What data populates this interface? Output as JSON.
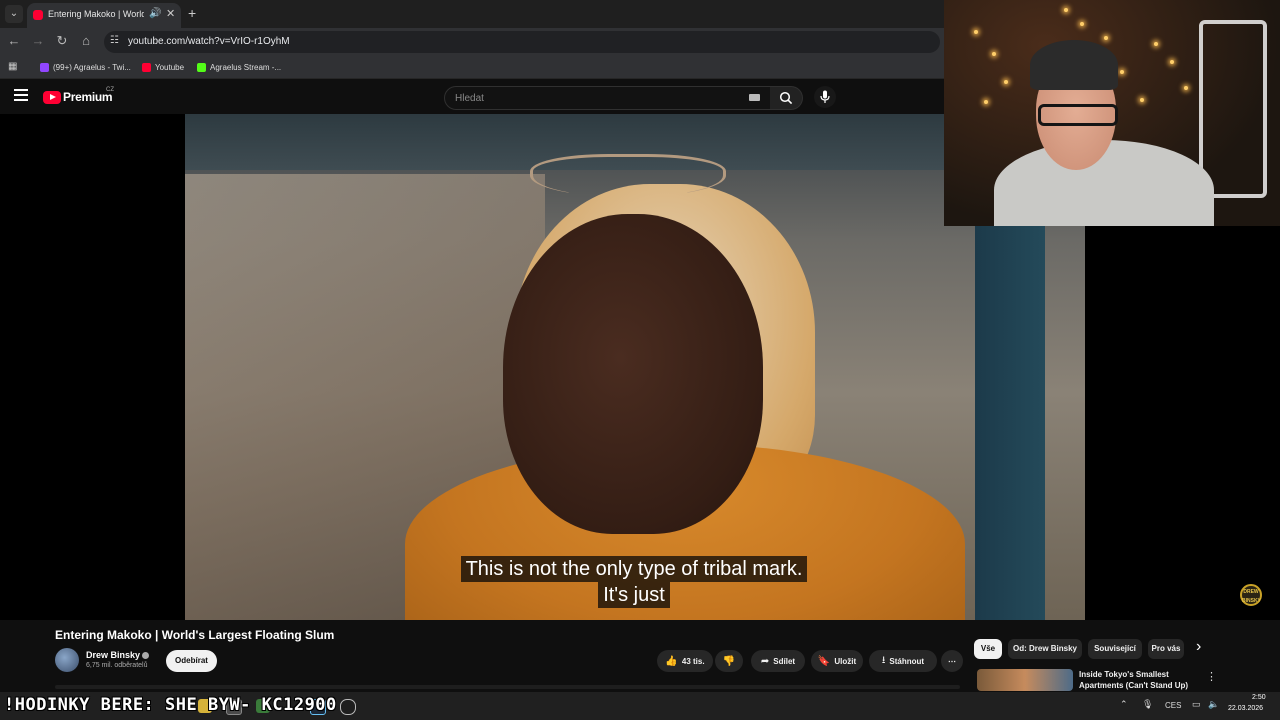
{
  "browser": {
    "tab": {
      "title": "Entering Makoko | World's La",
      "audio_icon": "speaker-icon",
      "close_glyph": "✕"
    },
    "new_tab_glyph": "+",
    "tab_search_glyph": "⌄",
    "nav": {
      "back": "←",
      "forward": "→",
      "reload": "↻",
      "home": "⌂"
    },
    "url": "youtube.com/watch?v=VrIO-r1OyhM",
    "bookmarks": [
      {
        "label": "(99+) Agraelus - Twi...",
        "color": "#9146ff"
      },
      {
        "label": "Youtube",
        "color": "#ff0033"
      },
      {
        "label": "Agraelus Stream -...",
        "color": "#53fc18"
      }
    ]
  },
  "youtube": {
    "brand": "Premium",
    "region": "CZ",
    "search_placeholder": "Hledat"
  },
  "video": {
    "subtitle_lines": [
      "This is not the only type of tribal mark.",
      "It's just"
    ],
    "watermark": "DREW BINSKY",
    "title": "Entering Makoko | World's Largest Floating Slum",
    "channel": {
      "name": "Drew Binsky",
      "subscribers": "6,75 mil. odběratelů"
    },
    "subscribe_label": "Odebírat",
    "actions": {
      "likes": "43 tis.",
      "share": "Sdílet",
      "save": "Uložit",
      "download": "Stáhnout",
      "more": "⋯"
    }
  },
  "recommendations": {
    "chips": [
      "Vše",
      "Od: Drew Binsky",
      "Související",
      "Pro vás"
    ],
    "next_glyph": "›",
    "items": [
      {
        "title": "Inside Tokyo's Smallest Apartments (Can't Stand Up)"
      }
    ]
  },
  "taskbar": {
    "ticker": "!HODINKY BERE: SHE  BYW- KC12900",
    "language": "CES",
    "time": "2:50",
    "date": "22.03.2026"
  },
  "colors": {
    "youtube_red": "#ff0033",
    "background": "#0f0f0f",
    "pill": "#272727"
  }
}
